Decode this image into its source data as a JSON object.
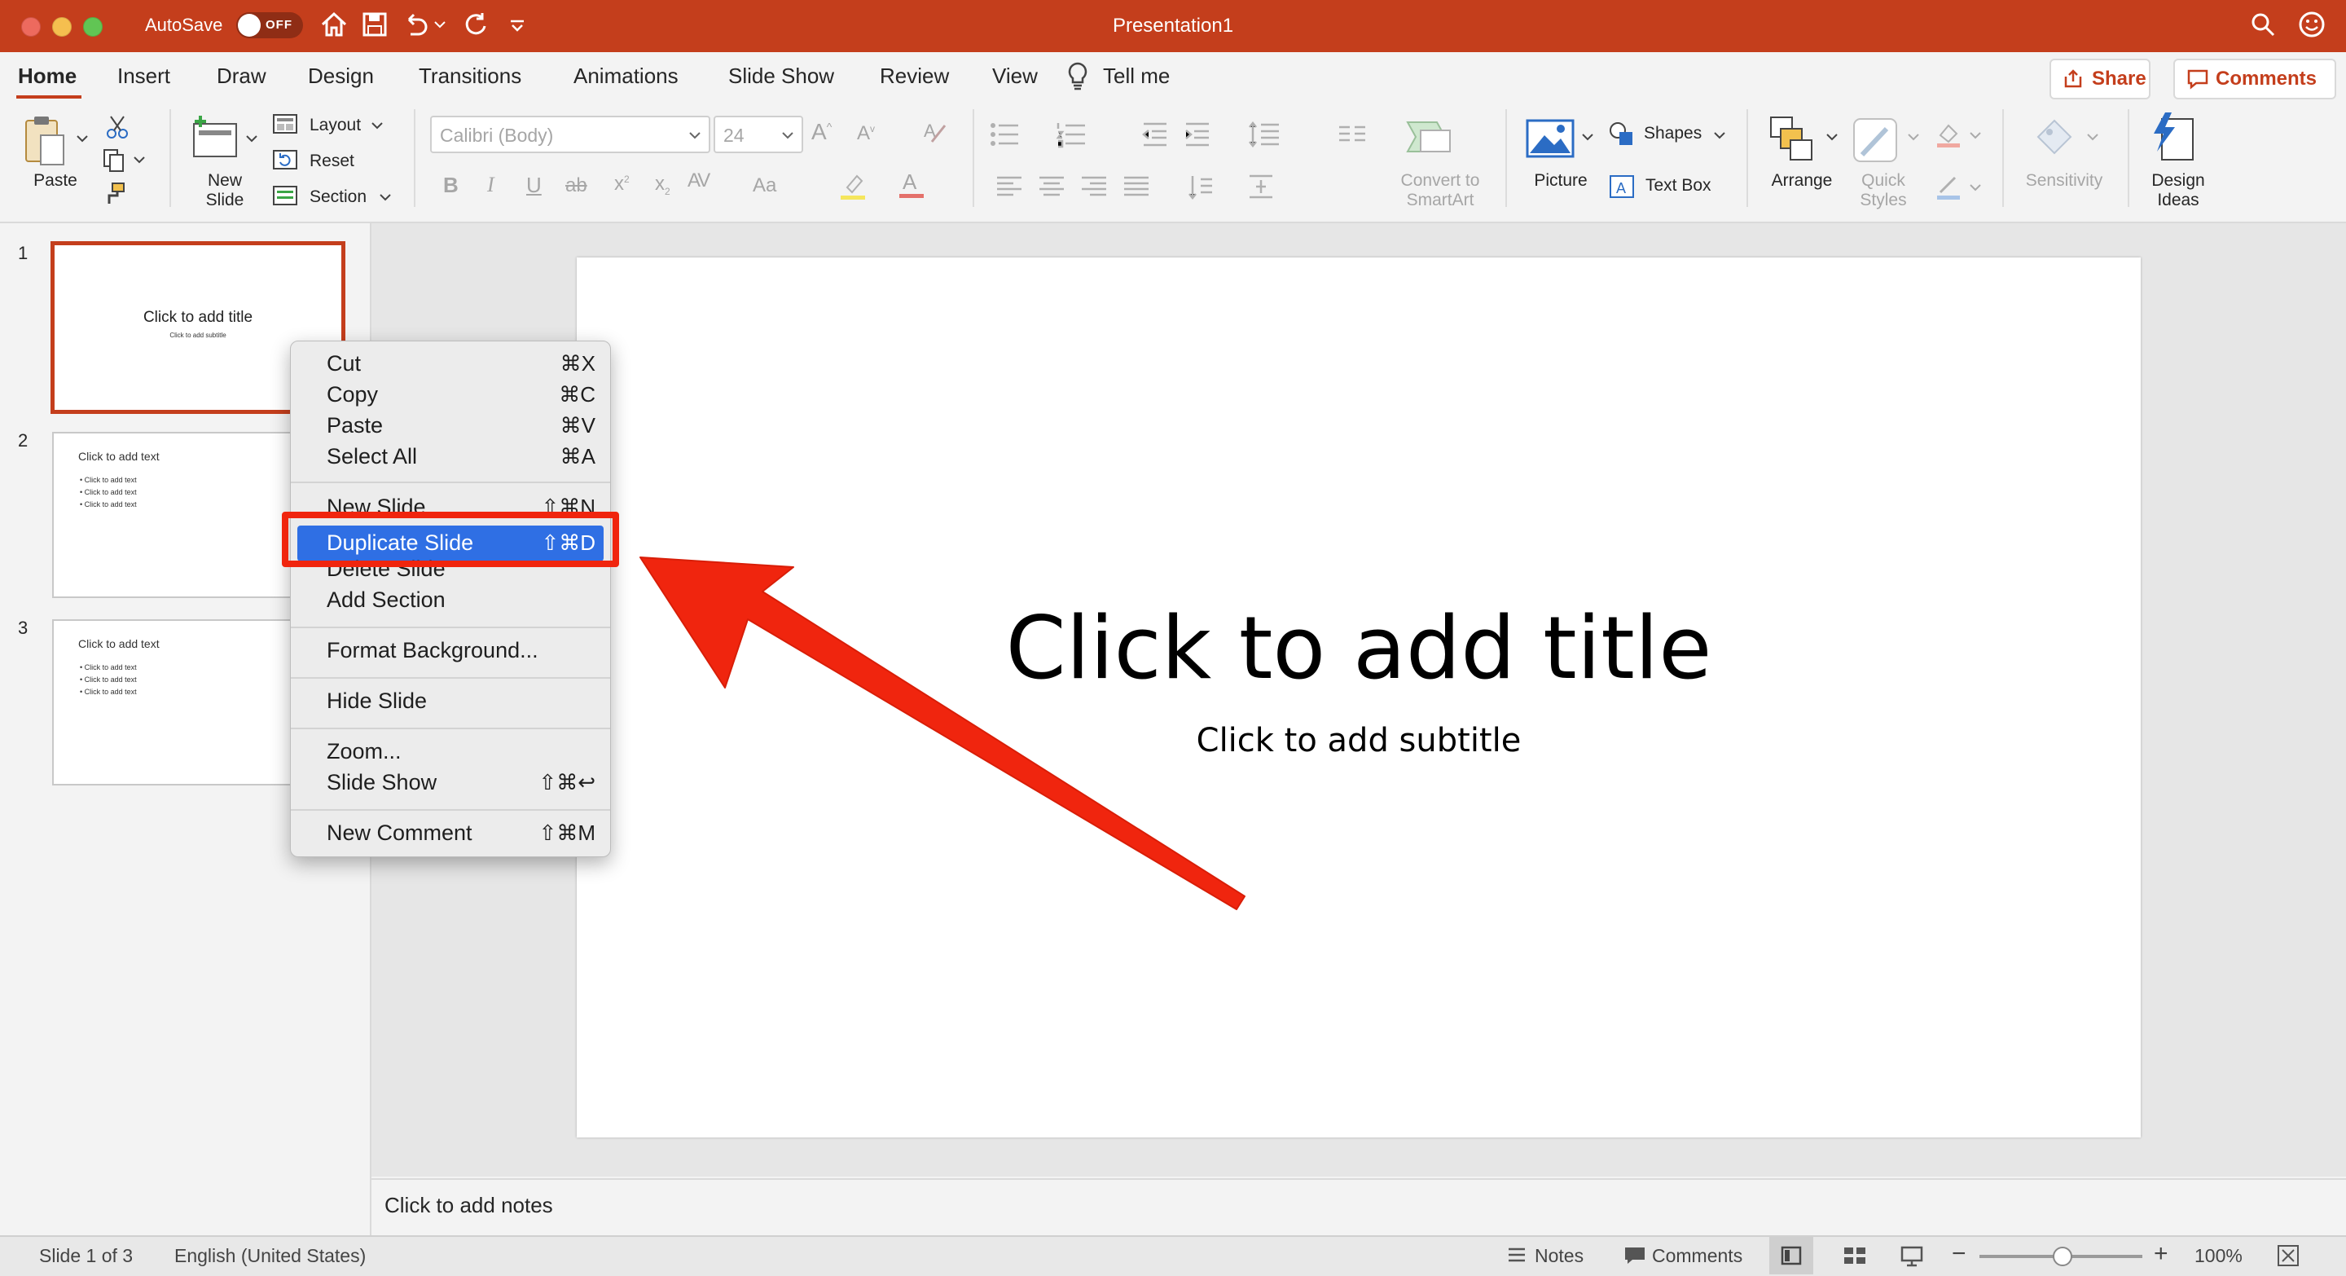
{
  "titlebar": {
    "autosave_label": "AutoSave",
    "autosave_state": "OFF",
    "document_title": "Presentation1"
  },
  "tabs": [
    "Home",
    "Insert",
    "Draw",
    "Design",
    "Transitions",
    "Animations",
    "Slide Show",
    "Review",
    "View",
    "Tell me"
  ],
  "share_label": "Share",
  "comments_label": "Comments",
  "ribbon": {
    "paste": "Paste",
    "new_slide_line1": "New",
    "new_slide_line2": "Slide",
    "layout": "Layout",
    "reset": "Reset",
    "section": "Section",
    "font_name": "Calibri (Body)",
    "font_size": "24",
    "convert_line1": "Convert to",
    "convert_line2": "SmartArt",
    "picture": "Picture",
    "shapes": "Shapes",
    "text_box": "Text Box",
    "arrange": "Arrange",
    "quick_line1": "Quick",
    "quick_line2": "Styles",
    "sensitivity": "Sensitivity",
    "design_line1": "Design",
    "design_line2": "Ideas"
  },
  "slides": [
    {
      "num": "1",
      "title": "Click to add title",
      "subtitle": "Click to add subtitle"
    },
    {
      "num": "2",
      "title": "Click to add text",
      "bullets": [
        "• Click to add text",
        "• Click to add text",
        "• Click to add text"
      ]
    },
    {
      "num": "3",
      "title": "Click to add text",
      "bullets": [
        "• Click to add text",
        "• Click to add text",
        "• Click to add text"
      ]
    }
  ],
  "context_menu": {
    "cut": {
      "label": "Cut",
      "shortcut": "⌘X"
    },
    "copy": {
      "label": "Copy",
      "shortcut": "⌘C"
    },
    "paste": {
      "label": "Paste",
      "shortcut": "⌘V"
    },
    "select_all": {
      "label": "Select All",
      "shortcut": "⌘A"
    },
    "new_slide": {
      "label": "New Slide",
      "shortcut": "⇧⌘N"
    },
    "duplicate_slide": {
      "label": "Duplicate Slide",
      "shortcut": "⇧⌘D"
    },
    "delete_slide": {
      "label": "Delete Slide"
    },
    "add_section": {
      "label": "Add Section"
    },
    "format_background": {
      "label": "Format Background..."
    },
    "hide_slide": {
      "label": "Hide Slide"
    },
    "zoom": {
      "label": "Zoom..."
    },
    "slide_show": {
      "label": "Slide Show",
      "shortcut": "⇧⌘↩"
    },
    "new_comment": {
      "label": "New Comment",
      "shortcut": "⇧⌘M"
    }
  },
  "main_slide": {
    "title": "Click to add title",
    "subtitle": "Click to add subtitle"
  },
  "notes_placeholder": "Click to add notes",
  "statusbar": {
    "slide_counter": "Slide 1 of 3",
    "language": "English (United States)",
    "notes": "Notes",
    "comments": "Comments",
    "zoom_level": "100%",
    "zoom_minus": "−",
    "zoom_plus": "+"
  },
  "colors": {
    "accent": "#c43e1c",
    "menu_highlight": "#2f6fe4",
    "annotation_red": "#f0250e"
  }
}
